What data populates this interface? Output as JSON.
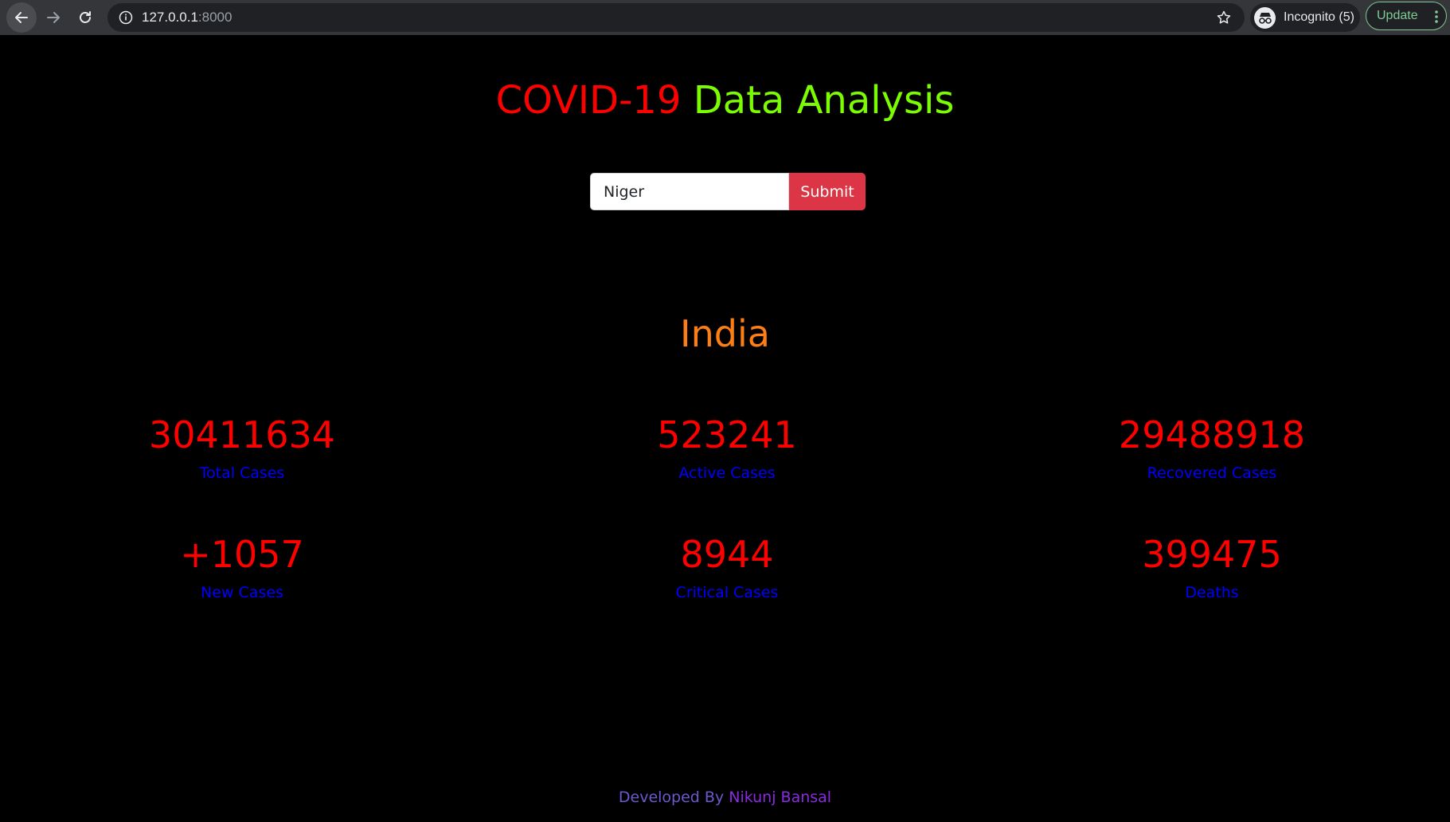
{
  "browser": {
    "url_host": "127.0.0.1",
    "url_port": ":8000",
    "profile_label": "Incognito (5)",
    "update_label": "Update"
  },
  "heading": {
    "part1": "COVID-19",
    "part2": "Data Analysis"
  },
  "search": {
    "value": "Niger",
    "submit_label": "Submit"
  },
  "country": "India",
  "stats": [
    {
      "value": "30411634",
      "label": "Total Cases"
    },
    {
      "value": "523241",
      "label": "Active Cases"
    },
    {
      "value": "29488918",
      "label": "Recovered Cases"
    },
    {
      "value": "+1057",
      "label": "New Cases"
    },
    {
      "value": "8944",
      "label": "Critical Cases"
    },
    {
      "value": "399475",
      "label": "Deaths"
    }
  ],
  "footer": {
    "prefix": "Developed By",
    "author": "Nikunj Bansal"
  },
  "colors": {
    "title_red": "#ff0000",
    "title_green": "#7cfc00",
    "country": "#fd7e14",
    "stat_value": "#ff0000",
    "stat_label": "#0000ff",
    "submit": "#dc3545",
    "page_bg": "#000000"
  }
}
